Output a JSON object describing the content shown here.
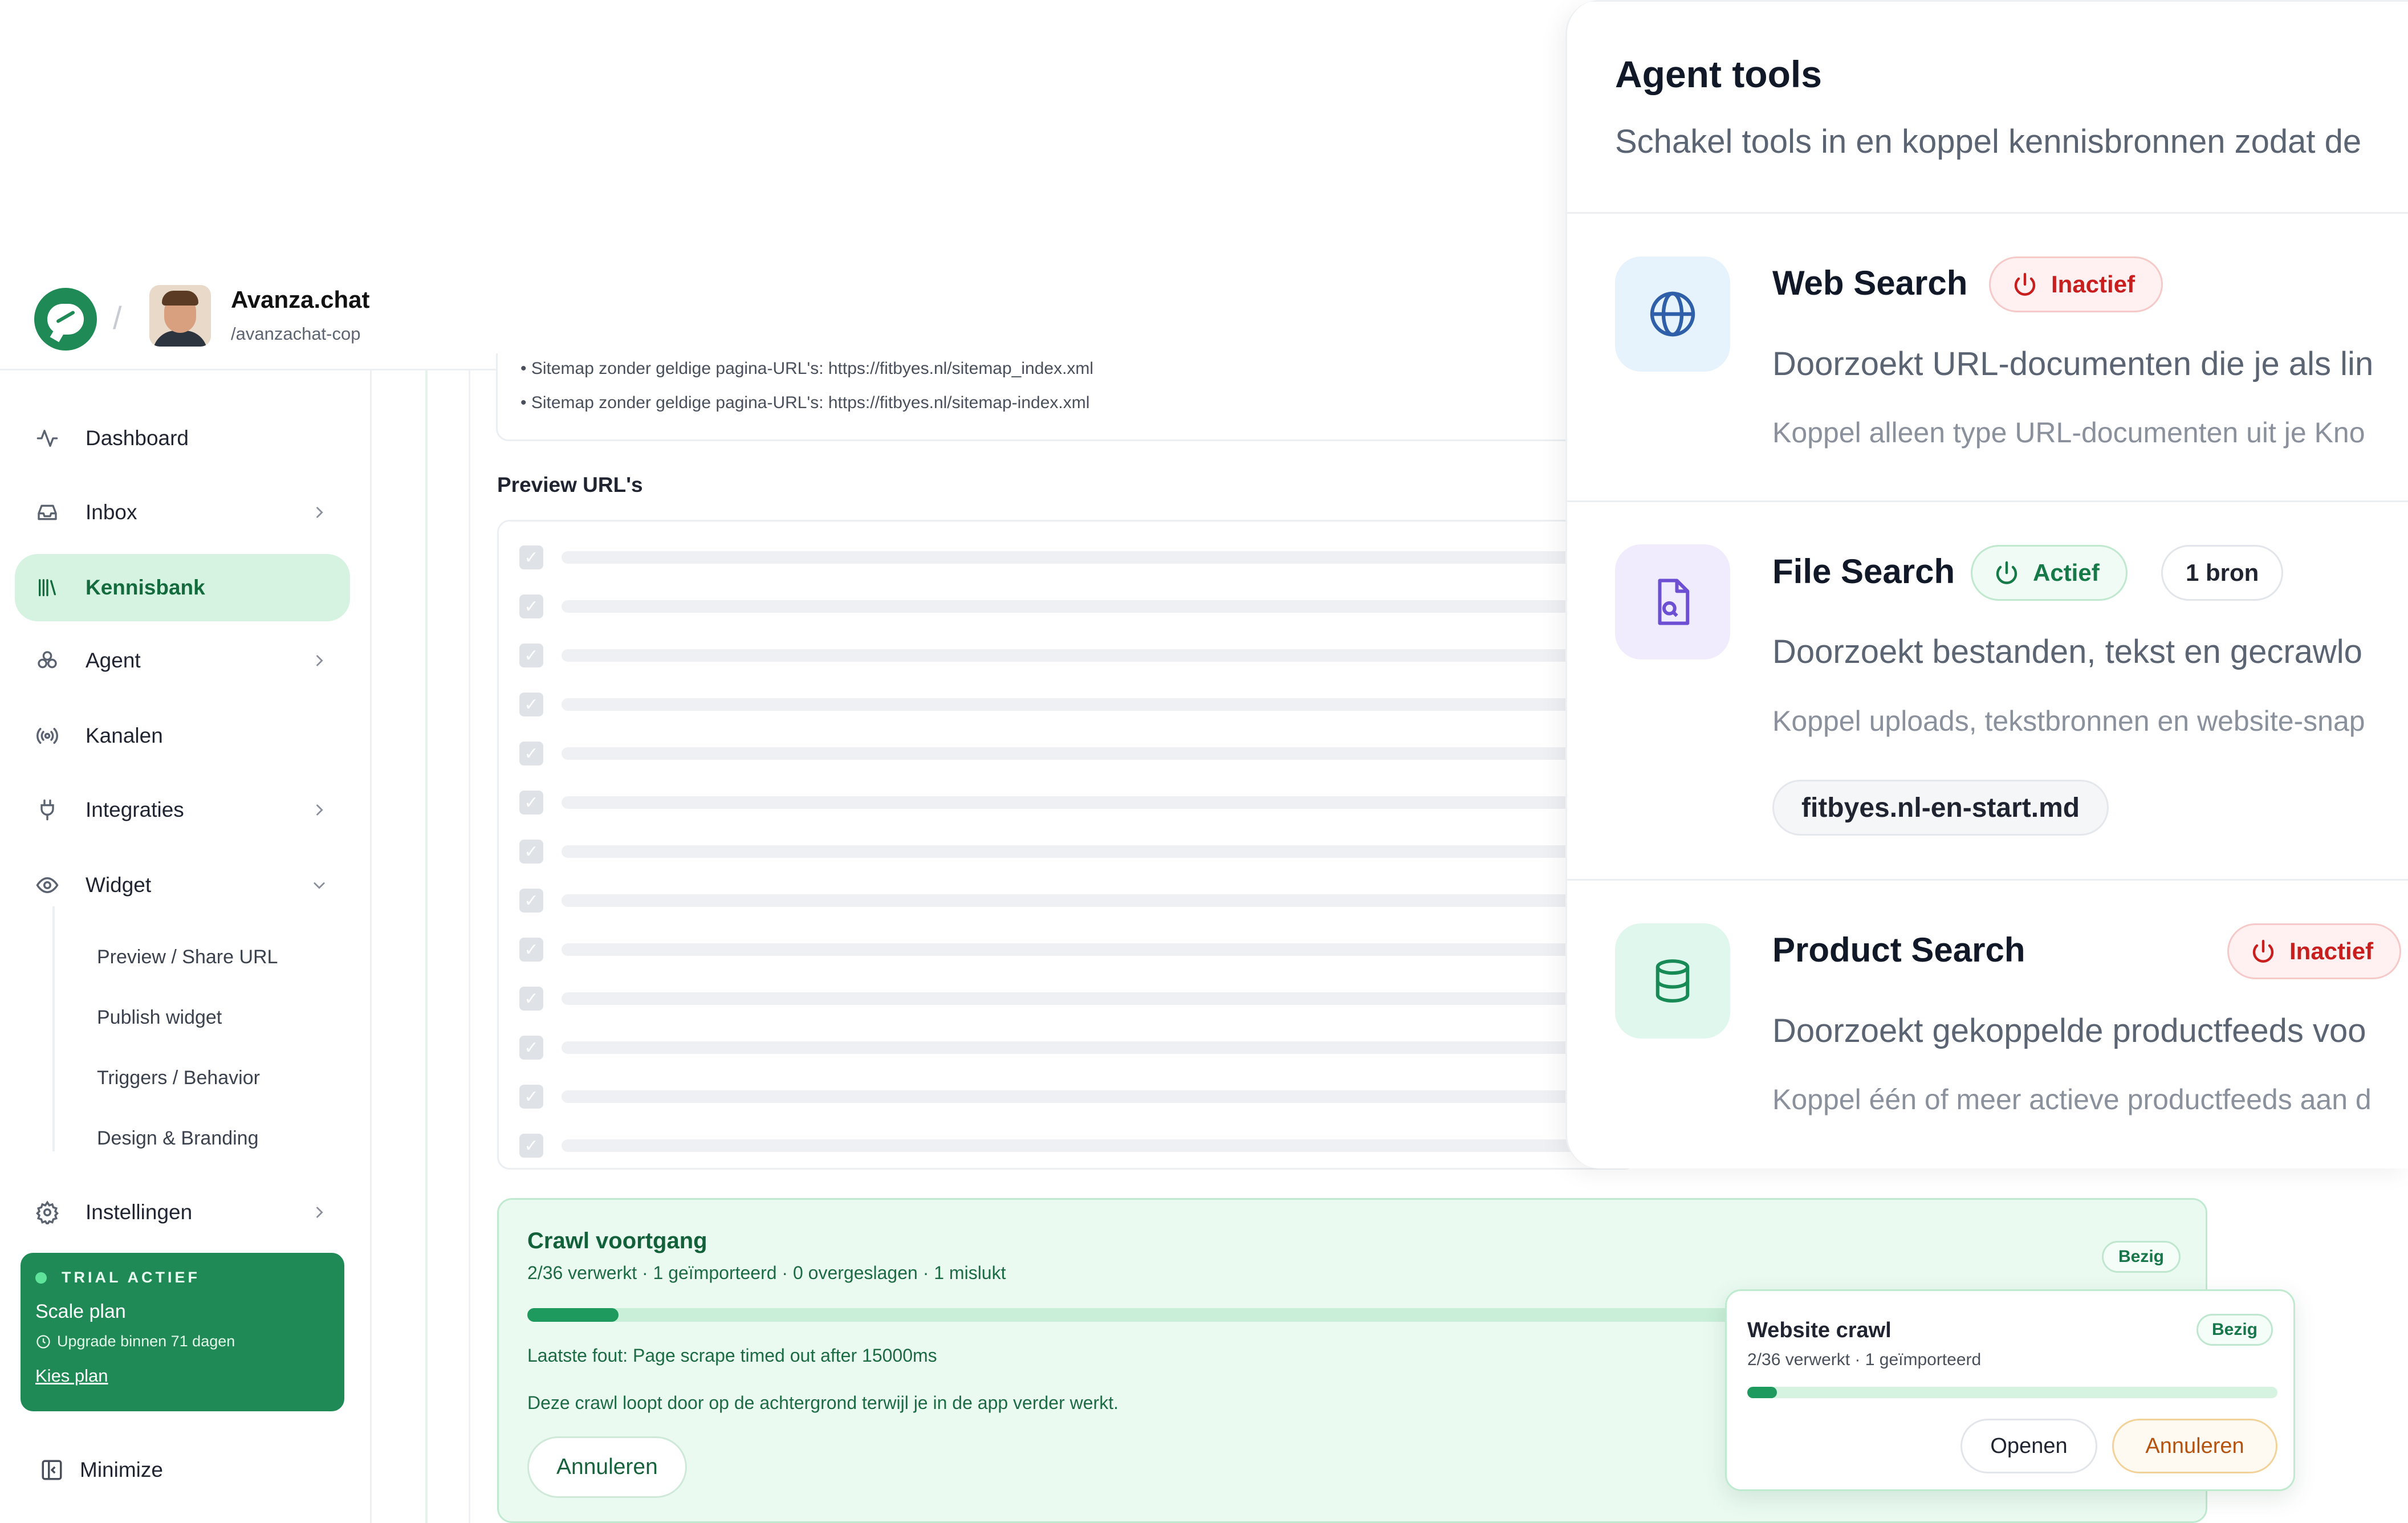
{
  "header": {
    "org_name": "Avanza.chat",
    "org_handle": "/avanzachat-cop",
    "separator": "/"
  },
  "sidebar": {
    "items": [
      {
        "label": "Dashboard",
        "icon": "activity-icon"
      },
      {
        "label": "Inbox",
        "icon": "inbox-icon"
      },
      {
        "label": "Kennisbank",
        "icon": "library-icon"
      },
      {
        "label": "Agent",
        "icon": "agent-icon"
      },
      {
        "label": "Kanalen",
        "icon": "broadcast-icon"
      },
      {
        "label": "Integraties",
        "icon": "plug-icon"
      },
      {
        "label": "Widget",
        "icon": "eye-icon"
      },
      {
        "label": "Instellingen",
        "icon": "gear-icon"
      }
    ],
    "widget_subitems": [
      "Preview / Share URL",
      "Publish widget",
      "Triggers / Behavior",
      "Design & Branding"
    ],
    "trial": {
      "title": "TRIAL ACTIEF",
      "plan": "Scale plan",
      "upgrade": "Upgrade binnen 71 dagen",
      "link": "Kies plan"
    },
    "minimize": "Minimize"
  },
  "main": {
    "sitemap_errors": [
      "• Sitemap zonder geldige pagina-URL's: https://fitbyes.nl/sitemap_index.xml",
      "• Sitemap zonder geldige pagina-URL's: https://fitbyes.nl/sitemap-index.xml"
    ],
    "preview_label": "Preview URL's",
    "preview_rows": 13,
    "crawl": {
      "title": "Crawl voortgang",
      "stats": "2/36 verwerkt · 1 geïmporteerd · 0 overgeslagen · 1 mislukt",
      "badge": "Bezig",
      "progress": 0.056,
      "last_error": "Laatste fout: Page scrape timed out after 15000ms",
      "note": "Deze crawl loopt door op de achtergrond terwijl je in de app verder werkt.",
      "cancel_label": "Annuleren"
    }
  },
  "popup": {
    "title": "Website crawl",
    "stats": "2/36 verwerkt · 1 geïmporteerd",
    "badge": "Bezig",
    "progress": 0.056,
    "open_label": "Openen",
    "cancel_label": "Annuleren"
  },
  "tools": {
    "title": "Agent tools",
    "description": "Schakel tools in en koppel kennisbronnen zodat de",
    "items": [
      {
        "name": "Web Search",
        "status": "Inactief",
        "description": "Doorzoekt URL-documenten die je als lin",
        "hint": "Koppel alleen type URL-documenten uit je Kno",
        "icon": "globe-icon"
      },
      {
        "name": "File Search",
        "status": "Actief",
        "source_count": "1 bron",
        "description": "Doorzoekt bestanden, tekst en gecrawlo",
        "hint": "Koppel uploads, tekstbronnen en website-snap",
        "file_chip": "fitbyes.nl-en-start.md",
        "icon": "file-search-icon"
      },
      {
        "name": "Product Search",
        "status": "Inactief",
        "description": "Doorzoekt gekoppelde productfeeds voo",
        "hint": "Koppel één of meer actieve productfeeds aan d",
        "icon": "database-icon"
      }
    ]
  },
  "colors": {
    "brand_green": "#1f8a55",
    "active_bg": "#d6f3e2",
    "inactive_red": "#c81e1e",
    "active_green": "#157a48"
  }
}
